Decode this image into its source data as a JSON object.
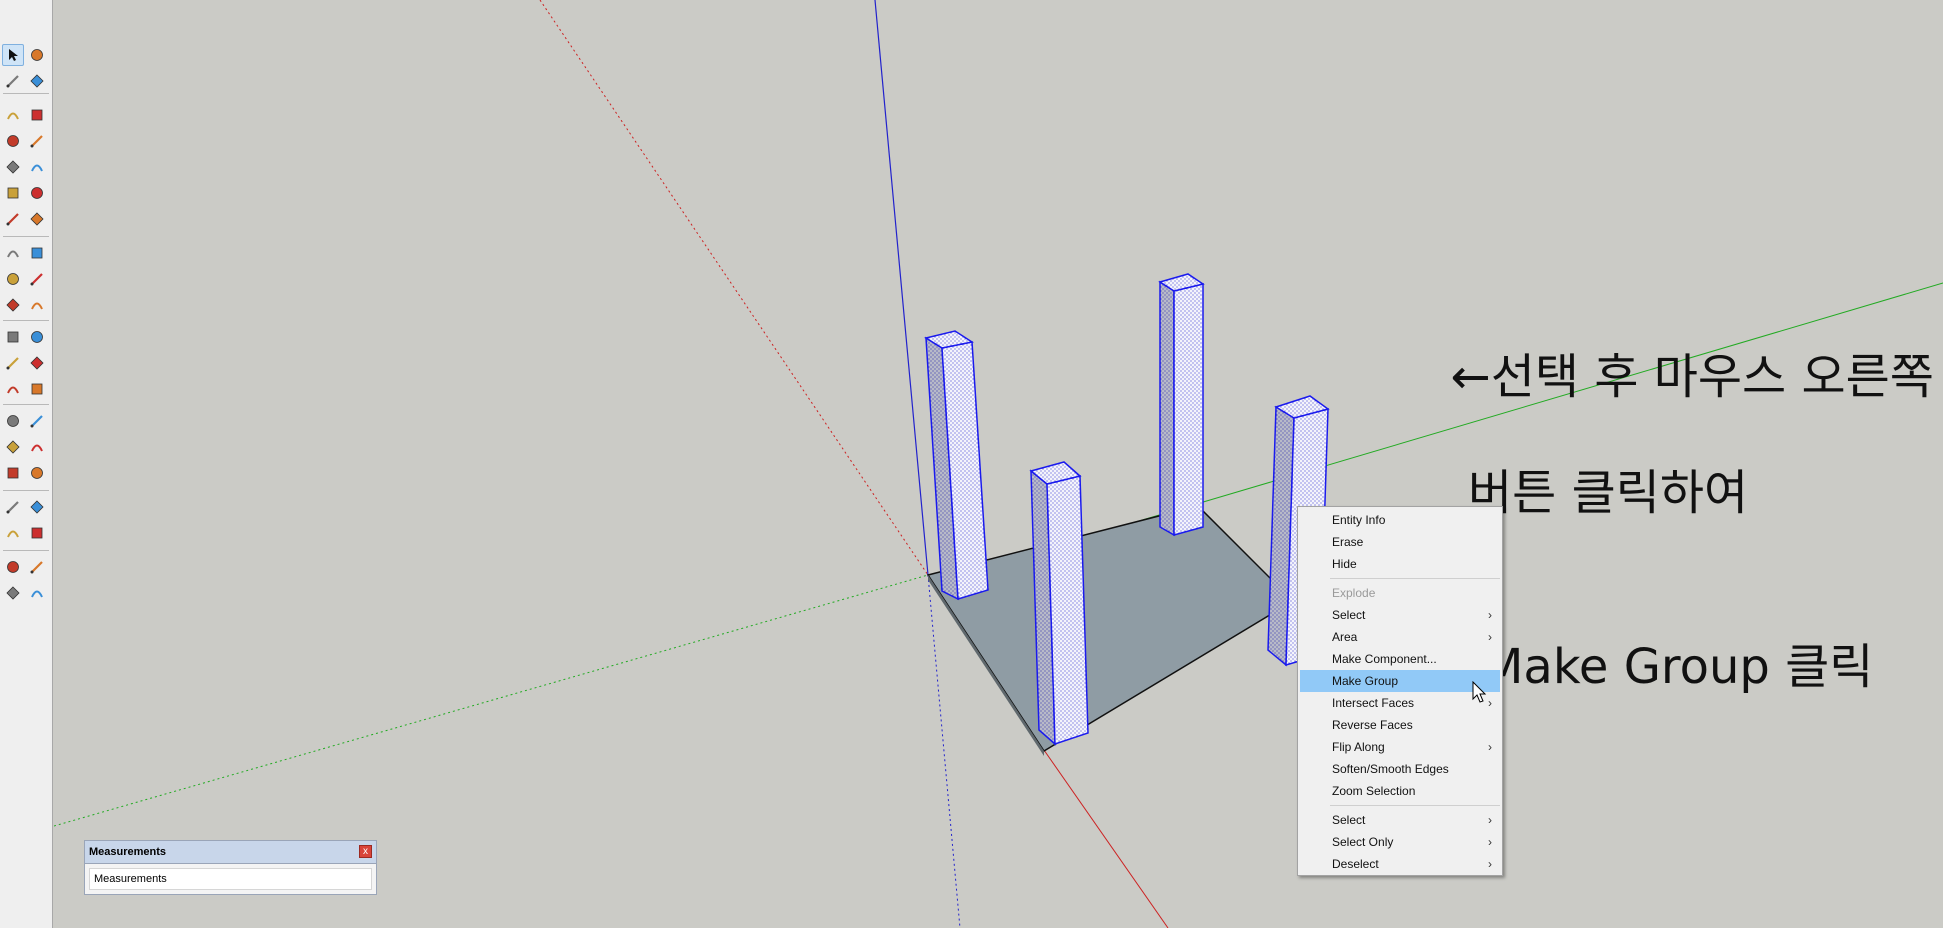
{
  "toolbar": {
    "tools": [
      [
        "select-tool",
        "make-component-tool"
      ],
      [
        "paint-bucket-tool",
        "eraser-tool"
      ],
      [
        "line-tool",
        "freehand-tool"
      ],
      [
        "rectangle-tool",
        "rotated-rectangle-tool"
      ],
      [
        "circle-tool",
        "polygon-tool"
      ],
      [
        "arc-tool",
        "two-point-arc-tool"
      ],
      [
        "three-point-arc-tool",
        "pie-tool"
      ],
      [
        "move-tool",
        "push-pull-tool"
      ],
      [
        "rotate-tool",
        "follow-me-tool"
      ],
      [
        "scale-tool",
        "offset-tool"
      ],
      [
        "tape-measure-tool",
        "dimension-tool"
      ],
      [
        "protractor-tool",
        "text-tool"
      ],
      [
        "axes-tool",
        "3d-text-tool"
      ],
      [
        "orbit-tool",
        "pan-tool"
      ],
      [
        "zoom-tool",
        "zoom-window-tool"
      ],
      [
        "zoom-extents-tool",
        "previous-view-tool"
      ],
      [
        "position-camera-tool",
        "look-around-tool"
      ],
      [
        "walk-tool",
        "section-plane-tool"
      ],
      [
        "warehouse-tool",
        "share-model-tool"
      ],
      [
        "extension-warehouse-tool",
        "send-to-layout-tool"
      ]
    ]
  },
  "annotation": {
    "line1": "←선택 후 마우스 오른쪽",
    "line2": "버튼 클릭하여",
    "line3": "Make Group 클릭"
  },
  "measurements": {
    "title": "Measurements",
    "close_label": "x",
    "field_label": "Measurements"
  },
  "context_menu": {
    "groups": [
      [
        {
          "label": "Entity Info",
          "submenu": false,
          "disabled": false
        },
        {
          "label": "Erase",
          "submenu": false,
          "disabled": false
        },
        {
          "label": "Hide",
          "submenu": false,
          "disabled": false
        }
      ],
      [
        {
          "label": "Explode",
          "submenu": false,
          "disabled": true
        },
        {
          "label": "Select",
          "submenu": true,
          "disabled": false
        },
        {
          "label": "Area",
          "submenu": true,
          "disabled": false
        },
        {
          "label": "Make Component...",
          "submenu": false,
          "disabled": false
        },
        {
          "label": "Make Group",
          "submenu": false,
          "disabled": false,
          "highlighted": true
        },
        {
          "label": "Intersect Faces",
          "submenu": true,
          "disabled": false
        },
        {
          "label": "Reverse Faces",
          "submenu": false,
          "disabled": false
        },
        {
          "label": "Flip Along",
          "submenu": true,
          "disabled": false
        },
        {
          "label": "Soften/Smooth Edges",
          "submenu": false,
          "disabled": false
        },
        {
          "label": "Zoom Selection",
          "submenu": false,
          "disabled": false
        }
      ],
      [
        {
          "label": "Select",
          "submenu": true,
          "disabled": false
        },
        {
          "label": "Select Only",
          "submenu": true,
          "disabled": false
        },
        {
          "label": "Deselect",
          "submenu": true,
          "disabled": false
        }
      ]
    ]
  },
  "colors": {
    "background": "#cbcbc6",
    "red_axis": "#cc2222",
    "green_axis": "#22aa22",
    "blue_axis": "#2222cc",
    "base_face": "#8f9ca4",
    "selection_blue": "#1a1aee",
    "menu_highlight": "#91c9f7"
  }
}
